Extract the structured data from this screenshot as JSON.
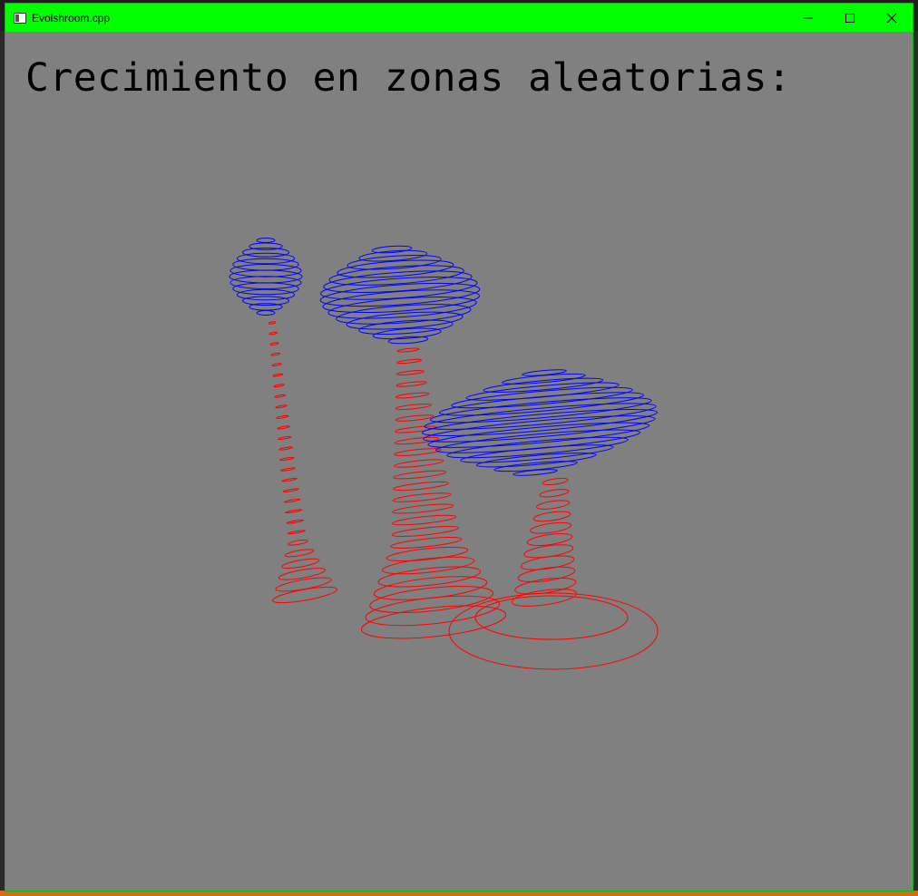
{
  "window": {
    "title": "Evolshroom.cpp",
    "titlebar_color": "#00ff00",
    "controls": [
      "minimize-icon",
      "maximize-icon",
      "close-icon"
    ]
  },
  "canvas": {
    "background": "#808080",
    "heading": "Crecimiento en zonas aleatorias:",
    "stem_color": "#ff0000",
    "cap_color": "#0000ff"
  }
}
